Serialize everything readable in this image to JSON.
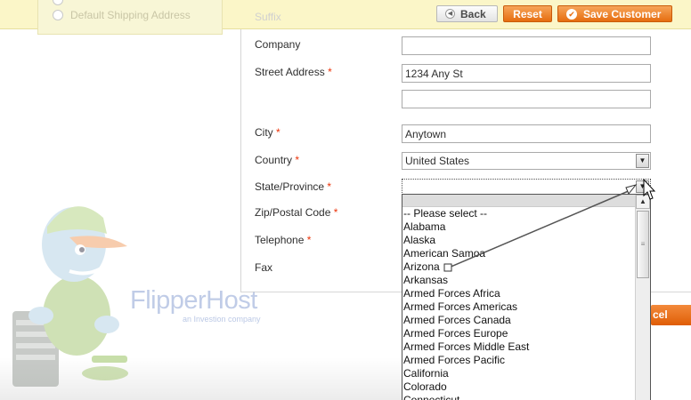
{
  "sidebar": {
    "shipping_option_label": "Default Shipping Address"
  },
  "toolbar": {
    "back_label": "Back",
    "reset_label": "Reset",
    "save_label": "Save Customer"
  },
  "form": {
    "suffix_label": "Suffix",
    "company_label": "Company",
    "company_value": "",
    "street_label": "Street Address",
    "street_line1": "1234 Any St",
    "street_line2": "",
    "city_label": "City",
    "city_value": "Anytown",
    "country_label": "Country",
    "country_value": "United States",
    "state_label": "State/Province",
    "state_value": "",
    "zip_label": "Zip/Postal Code",
    "telephone_label": "Telephone",
    "fax_label": "Fax",
    "required_mark": "*"
  },
  "state_dropdown": {
    "options": [
      "-- Please select --",
      "Alabama",
      "Alaska",
      "American Samoa",
      "Arizona",
      "Arkansas",
      "Armed Forces Africa",
      "Armed Forces Americas",
      "Armed Forces Canada",
      "Armed Forces Europe",
      "Armed Forces Middle East",
      "Armed Forces Pacific",
      "California",
      "Colorado",
      "Connecticut"
    ]
  },
  "cancel_stub_label": "cel",
  "watermark": {
    "brand": "FlipperHost",
    "tagline": "an Investion company"
  },
  "colors": {
    "accent": "#e66d10",
    "header_bg": "#fbf6c8",
    "required": "#eb340a"
  }
}
